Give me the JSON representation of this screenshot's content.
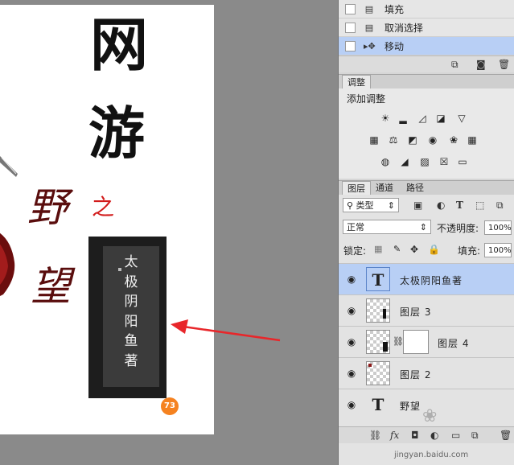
{
  "canvas": {
    "title_char_1": "网",
    "title_char_2": "游",
    "char_ye": "野",
    "char_zhi": "之",
    "char_wang": "望",
    "vertical_text": [
      "太",
      "极",
      "阴",
      "阳",
      "鱼",
      "著"
    ]
  },
  "history": {
    "items": [
      {
        "label": "填充",
        "icon": "fill-history-icon"
      },
      {
        "label": "取消选择",
        "icon": "deselect-history-icon"
      },
      {
        "label": "移动",
        "icon": "move-tool-icon",
        "selected": true
      }
    ]
  },
  "adjustments": {
    "tab": "调整",
    "title": "添加调整"
  },
  "layers": {
    "tabs": [
      "图层",
      "通道",
      "路径"
    ],
    "filter_kind": "类型",
    "blend_mode": "正常",
    "opacity_label": "不透明度:",
    "opacity_value": "100%",
    "lock_label": "锁定:",
    "fill_label": "填充:",
    "fill_value": "100%",
    "items": [
      {
        "name": "太极阴阳鱼著",
        "type": "text",
        "selected": true
      },
      {
        "name": "图层 3",
        "type": "raster"
      },
      {
        "name": "图层 4",
        "type": "masked"
      },
      {
        "name": "图层 2",
        "type": "raster"
      },
      {
        "name": "野望",
        "type": "text"
      }
    ]
  },
  "badge": "73",
  "watermark": "jingyan.baidu.com",
  "colors": {
    "selected_row": "#b8cff5",
    "annotation_arrow": "#e8262a",
    "badge": "#f58220"
  }
}
